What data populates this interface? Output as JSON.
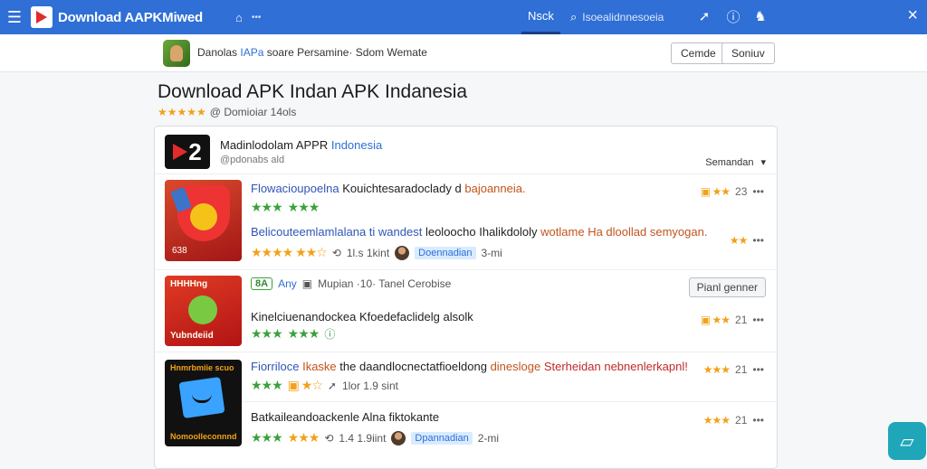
{
  "topbar": {
    "brand": "Download AAPKMiwed",
    "nav_tab": "Nsck",
    "search_text": "Isoealidnnesoeia"
  },
  "strip": {
    "title_a": "Danolas",
    "title_b": "IAPa",
    "title_c": "soare Persamine· Sdom Wemate",
    "btn_1": "Cemde",
    "btn_2": "Soniuv"
  },
  "page": {
    "title": "Download APK Indan APK Indanesia",
    "meta": "@ Domioiar 14ols"
  },
  "card": {
    "logo_num": "2",
    "title_a": "Madinlodolam APPR",
    "title_b": "Indonesia",
    "subtitle": "@pdonabs ald",
    "sort_label": "Semandan"
  },
  "rows": [
    {
      "thumb_text": "638",
      "line1_a": "Flowacioupoelna",
      "line1_b": "Kouichtesaradoclady d",
      "line1_c": "bajoanneia.",
      "right1": "23",
      "line2_a": "Belicouteemlamlalana ti wandest",
      "line2_b": "leoloocho Ihalikdololy",
      "line2_c": "wotlame Ha dloollad semyogan.",
      "stat_a": "1l.s 1kint",
      "chip": "Doennadian",
      "stat_b": "3-mi"
    },
    {
      "thumb_top": "HHHHng",
      "thumb_text": "Yubndeiid",
      "badge": "8A",
      "tag": "Any",
      "tag_meta": "Mupian ·10· Tanel Cerobise",
      "action": "Pianl genner",
      "line1": "Kinelciuenandockea Kfoedefaclidelg alsolk",
      "right1": "21"
    },
    {
      "thumb_top": "Hnmrbmiie scuo",
      "thumb_text": "Nomoolleconnnd",
      "line1_a": "Fiorriloce",
      "line1_b": "Ikaske",
      "line1_c": "the daandlocnectatfioeldong",
      "line1_d": "dinesloge",
      "line1_e": "Sterheidan nebnenlerkapnl!",
      "right1": "21",
      "stat_a": "1lor 1.9 sint"
    },
    {
      "line1": "Batkaileandoackenle Alna fiktokante",
      "right1": "21",
      "stat_a": "1.4 1.9iint",
      "chip": "Dpannadian",
      "stat_b": "2-mi"
    }
  ]
}
